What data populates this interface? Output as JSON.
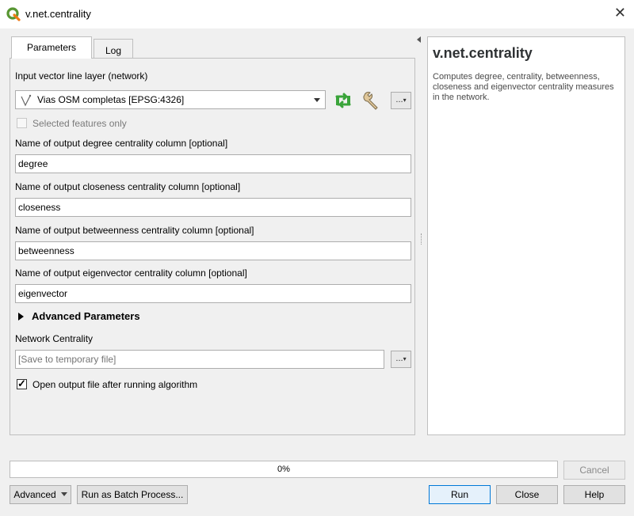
{
  "window": {
    "title": "v.net.centrality",
    "close_label": "✕"
  },
  "tabs": [
    {
      "label": "Parameters"
    },
    {
      "label": "Log"
    }
  ],
  "form": {
    "input_layer_label": "Input vector line layer (network)",
    "input_layer_value": "Vias OSM completas [EPSG:4326]",
    "selected_only_label": "Selected features only",
    "selected_only_checked": false,
    "degree_label": "Name of output degree centrality column [optional]",
    "degree_value": "degree",
    "closeness_label": "Name of output closeness centrality column [optional]",
    "closeness_value": "closeness",
    "betweenness_label": "Name of output betweenness centrality column [optional]",
    "betweenness_value": "betweenness",
    "eigenvector_label": "Name of output eigenvector centrality column [optional]",
    "eigenvector_value": "eigenvector",
    "advanced_header": "Advanced Parameters",
    "network_centrality_label": "Network Centrality",
    "network_centrality_placeholder": "[Save to temporary file]",
    "open_output_label": "Open output file after running algorithm",
    "open_output_checked": true,
    "dots_label": "..."
  },
  "help": {
    "title": "v.net.centrality",
    "description": "Computes degree, centrality, betweenness, closeness and eigenvector centrality measures in the network."
  },
  "progress": {
    "value": 0,
    "text": "0%"
  },
  "buttons": {
    "advanced": "Advanced",
    "batch": "Run as Batch Process...",
    "cancel": "Cancel",
    "run": "Run",
    "close": "Close",
    "help": "Help"
  },
  "icons": {
    "app": "qgis-logo-icon",
    "layer": "line-layer-icon",
    "iterate": "iterate-icon",
    "settings": "wrench-icon"
  },
  "colors": {
    "qgis_green": "#589632",
    "qgis_yellow": "#ee7913",
    "default_button_border": "#0078d7"
  }
}
